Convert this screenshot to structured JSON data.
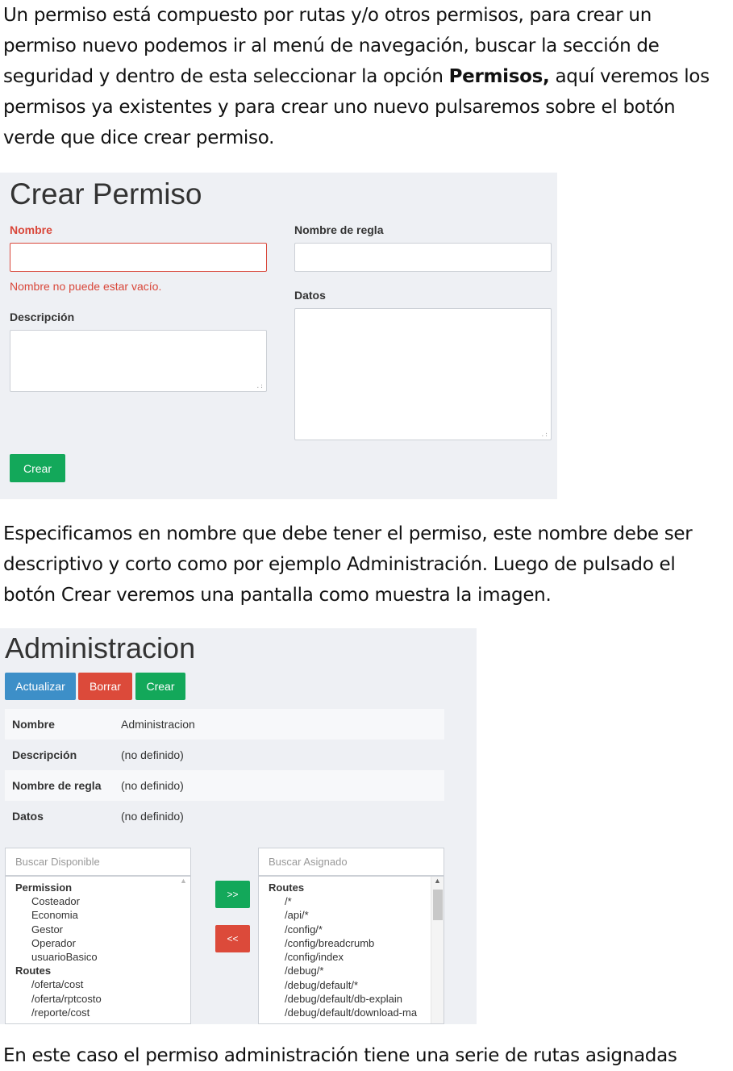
{
  "intro": {
    "line1": "Un permiso está compuesto por rutas y/o otros permisos, para crear un",
    "line2": "permiso nuevo podemos ir al menú de navegación, buscar la sección de",
    "line3_before": "seguridad y dentro de esta seleccionar la opción ",
    "line3_bold": "Permisos,",
    "line3_after": " aquí veremos los",
    "line4": "permisos ya existentes y para crear uno nuevo pulsaremos sobre el botón",
    "line5": "verde que dice crear permiso."
  },
  "create_form": {
    "title": "Crear Permiso",
    "nombre_label": "Nombre",
    "nombre_value": "",
    "nombre_error": "Nombre no puede estar vacío.",
    "descripcion_label": "Descripción",
    "regla_label": "Nombre de regla",
    "datos_label": "Datos",
    "crear_button": "Crear"
  },
  "middle": {
    "line1": "Especificamos en nombre que debe tener el permiso, este nombre debe ser",
    "line2": "descriptivo y corto como por ejemplo Administración. Luego de pulsado el",
    "line3": "botón Crear veremos una pantalla como muestra la imagen."
  },
  "admin_view": {
    "title": "Administracion",
    "buttons": {
      "actualizar": "Actualizar",
      "borrar": "Borrar",
      "crear": "Crear"
    },
    "details": [
      {
        "key": "Nombre",
        "value": "Administracion"
      },
      {
        "key": "Descripción",
        "value": "(no definido)"
      },
      {
        "key": "Nombre de regla",
        "value": "(no definido)"
      },
      {
        "key": "Datos",
        "value": "(no definido)"
      }
    ],
    "available": {
      "search_placeholder": "Buscar Disponible",
      "group1": "Permission",
      "group1_items": [
        "Costeador",
        "Economia",
        "Gestor",
        "Operador",
        "usuarioBasico"
      ],
      "group2": "Routes",
      "group2_items": [
        "/oferta/cost",
        "/oferta/rptcosto",
        "/reporte/cost"
      ]
    },
    "assign_button": ">>",
    "remove_button": "<<",
    "assigned": {
      "search_placeholder": "Buscar Asignado",
      "group1": "Routes",
      "group1_items": [
        "/*",
        "/api/*",
        "/config/*",
        "/config/breadcrumb",
        "/config/index",
        "/debug/*",
        "/debug/default/*",
        "/debug/default/db-explain",
        "/debug/default/download-ma"
      ]
    }
  },
  "footer": {
    "line1": "En este caso el permiso administración tiene una serie de rutas asignadas"
  }
}
